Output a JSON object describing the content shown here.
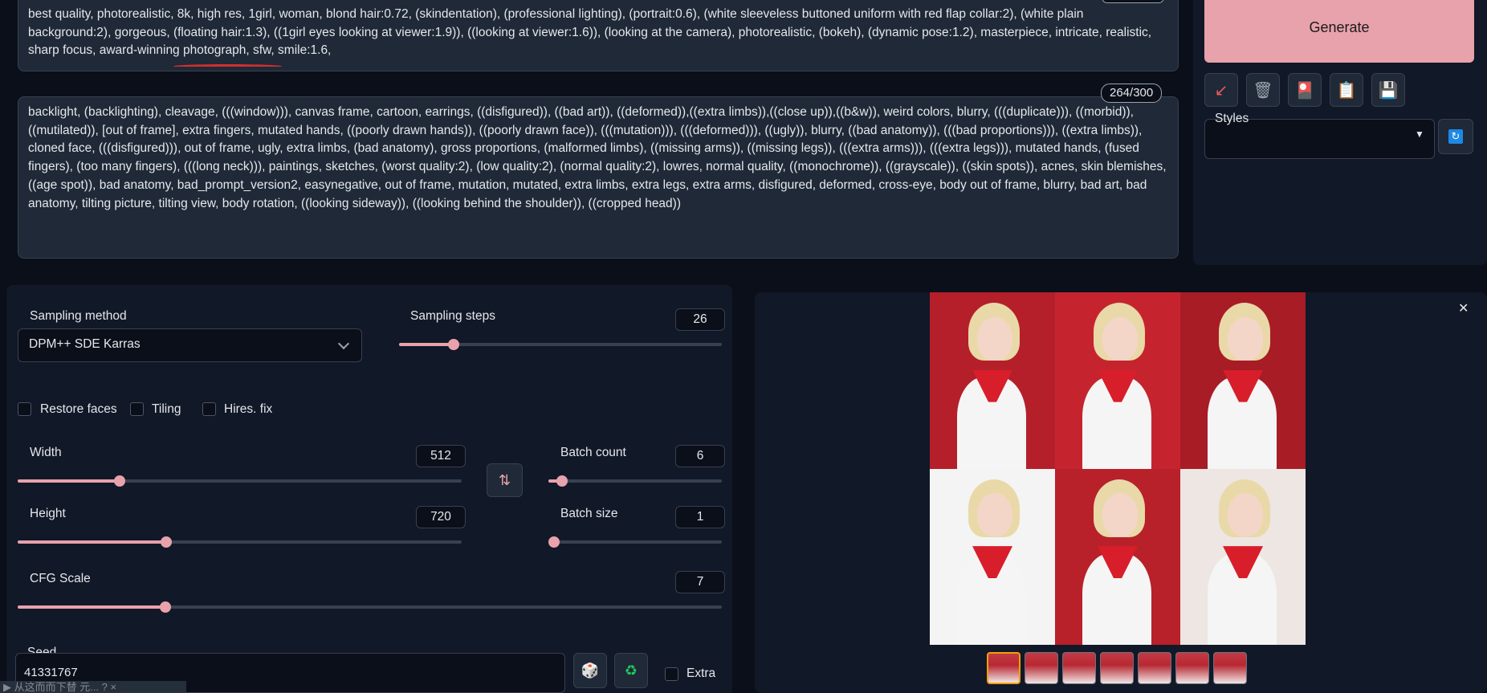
{
  "prompt": {
    "text": "best quality, photorealistic, 8k, high res, 1girl, woman, blond hair:0.72, (skindentation), (professional lighting), (portrait:0.6), (white sleeveless buttoned uniform with red flap collar:2), (white plain background:2), gorgeous, (floating hair:1.3), ((1girl eyes looking at viewer:1.9)), ((looking at viewer:1.6)), (looking at the camera), photorealistic, (bokeh), (dynamic pose:1.2), masterpiece, intricate, realistic, sharp focus, award-winning photograph, sfw, smile:1.6,"
  },
  "negative_prompt": {
    "counter": "264/300",
    "text": "backlight, (backlighting), cleavage, (((window))), canvas frame, cartoon, earrings, ((disfigured)), ((bad art)), ((deformed)),((extra limbs)),((close up)),((b&w)), weird colors, blurry, (((duplicate))), ((morbid)), ((mutilated)), [out of frame], extra fingers, mutated hands, ((poorly drawn hands)), ((poorly drawn face)), (((mutation))), (((deformed))), ((ugly)), blurry, ((bad anatomy)), (((bad proportions))), ((extra limbs)), cloned face, (((disfigured))), out of frame, ugly, extra limbs, (bad anatomy), gross proportions, (malformed limbs), ((missing arms)), ((missing legs)), (((extra arms))), (((extra legs))), mutated hands, (fused fingers), (too many fingers), (((long neck))), paintings, sketches, (worst quality:2), (low quality:2), (normal quality:2), lowres, normal quality, ((monochrome)), ((grayscale)), ((skin spots)), acnes, skin blemishes, ((age spot)), bad anatomy, bad_prompt_version2, easynegative, out of frame, mutation, mutated, extra limbs, extra legs, extra arms, disfigured, deformed, cross-eye, body out of frame, blurry, bad art, bad anatomy, tilting picture, tilting view, body rotation, ((looking sideway)), ((looking behind the shoulder)), ((cropped head))"
  },
  "actions": {
    "generate_label": "Generate",
    "styles_label": "Styles",
    "styles_value": ""
  },
  "settings": {
    "sampling_method_label": "Sampling method",
    "sampling_method_value": "DPM++ SDE Karras",
    "sampling_steps_label": "Sampling steps",
    "sampling_steps_value": "26",
    "sampling_steps_fraction": 0.17,
    "restore_faces_label": "Restore faces",
    "tiling_label": "Tiling",
    "hires_fix_label": "Hires. fix",
    "width_label": "Width",
    "width_value": "512",
    "width_fraction": 0.23,
    "height_label": "Height",
    "height_value": "720",
    "height_fraction": 0.335,
    "batch_count_label": "Batch count",
    "batch_count_value": "6",
    "batch_count_fraction": 0.08,
    "batch_size_label": "Batch size",
    "batch_size_value": "1",
    "batch_size_fraction": 0.0,
    "cfg_scale_label": "CFG Scale",
    "cfg_scale_value": "7",
    "cfg_scale_fraction": 0.21,
    "seed_label": "Seed",
    "seed_value": "41331767",
    "extra_label": "Extra"
  },
  "bottom_tip": "▶ 从这而而下替 元... ?  ×",
  "colors": {
    "accent": "#e8a2ac",
    "background": "#0b0f19",
    "panel": "#111827",
    "collar_red": "#d81e2a"
  },
  "gallery": {
    "cell_backgrounds": [
      "#b41f2a",
      "#c5242e",
      "#a81c26",
      "#f4f4f4",
      "#b8202a",
      "#ede6e2"
    ],
    "thumbnail_count": 7,
    "selected_thumbnail": 0
  },
  "icons": [
    "arrow-icon",
    "trash-icon",
    "style-icon",
    "clipboard-icon",
    "save-icon",
    "refresh-icon",
    "swap-icon",
    "dice-icon",
    "recycle-icon",
    "close-icon"
  ]
}
